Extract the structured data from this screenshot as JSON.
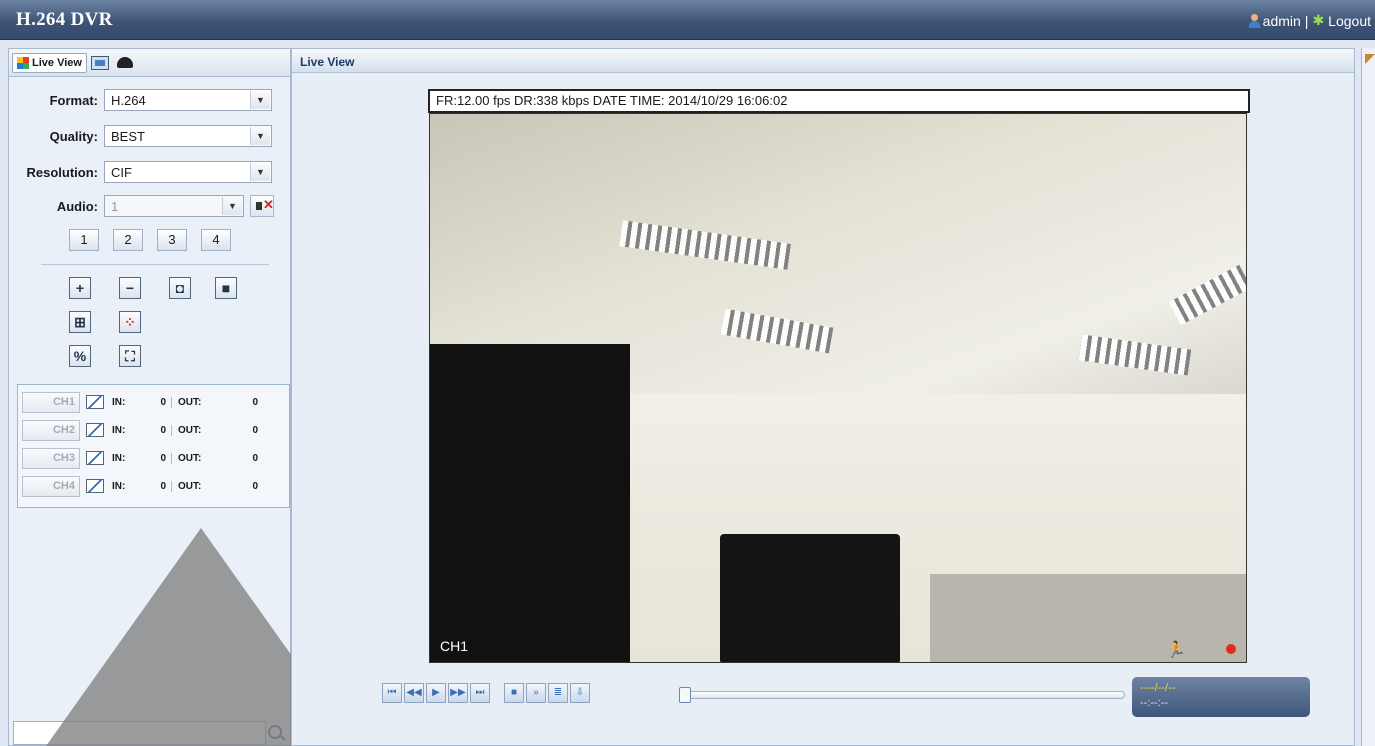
{
  "app": {
    "title": "H.264 DVR"
  },
  "user": {
    "name": "admin",
    "separator": "|",
    "logout": "Logout"
  },
  "tabs": [
    {
      "label": "Live View"
    }
  ],
  "settings": {
    "format": {
      "label": "Format:",
      "value": "H.264"
    },
    "quality": {
      "label": "Quality:",
      "value": "BEST"
    },
    "resolution": {
      "label": "Resolution:",
      "value": "CIF"
    },
    "audio": {
      "label": "Audio:",
      "value": "1"
    }
  },
  "channel_buttons": [
    "1",
    "2",
    "3",
    "4"
  ],
  "counters": [
    {
      "ch": "CH1",
      "in_label": "IN:",
      "in": "0",
      "out_label": "OUT:",
      "out": "0"
    },
    {
      "ch": "CH2",
      "in_label": "IN:",
      "in": "0",
      "out_label": "OUT:",
      "out": "0"
    },
    {
      "ch": "CH3",
      "in_label": "IN:",
      "in": "0",
      "out_label": "OUT:",
      "out": "0"
    },
    {
      "ch": "CH4",
      "in_label": "IN:",
      "in": "0",
      "out_label": "OUT:",
      "out": "0"
    }
  ],
  "main": {
    "header": "Live View",
    "osd": "FR:12.00 fps  DR:338 kbps  DATE TIME: 2014/10/29 16:06:02",
    "channel_label": "CH1",
    "time_date": "----/--/--",
    "time_clock": "--:--:--"
  },
  "colors": {
    "titlebar": "#3f5577",
    "accent": "#2f6dbd",
    "record": "#e02b20"
  }
}
